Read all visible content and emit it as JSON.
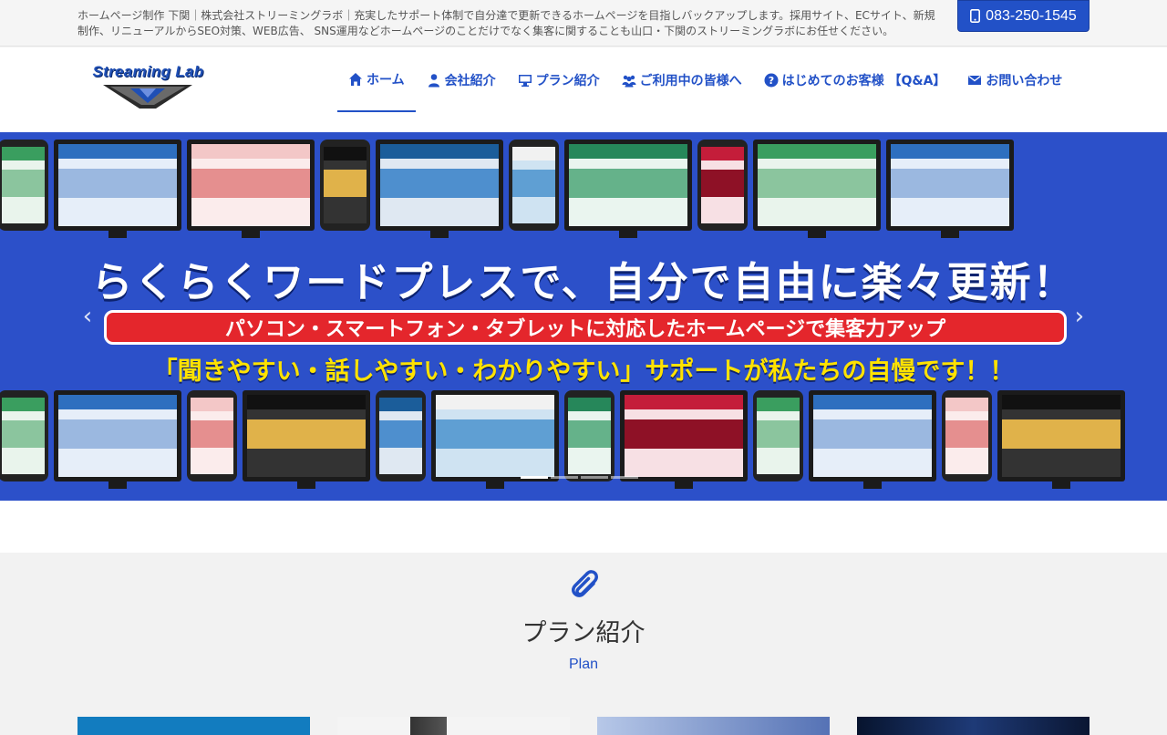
{
  "topbar": {
    "text": "ホームページ制作 下関｜株式会社ストリーミングラボ｜充実したサポート体制で自分達で更新できるホームページを目指しバックアップします。採用サイト、ECサイト、新規制作、リニューアルからSEO対策、WEB広告、 SNS運用などホームページのことだけでなく集客に関することも山口・下関のストリーミングラボにお任せください。",
    "phone": "083-250-1545",
    "phone_icon": "mobile-phone-icon"
  },
  "header": {
    "logo_text": "Streaming Lab",
    "nav": [
      {
        "label": "ホーム",
        "icon": "home-icon",
        "active": true
      },
      {
        "label": "会社紹介",
        "icon": "person-icon",
        "active": false
      },
      {
        "label": "プラン紹介",
        "icon": "monitor-icon",
        "active": false
      },
      {
        "label": "ご利用中の皆様へ",
        "icon": "group-icon",
        "active": false
      },
      {
        "label": "はじめてのお客様 【Q&A】",
        "icon": "question-icon",
        "active": false
      },
      {
        "label": "お問い合わせ",
        "icon": "mail-icon",
        "active": false
      }
    ]
  },
  "hero": {
    "headline": "らくらくワードプレスで、自分で自由に楽々更新！",
    "ribbon": "パソコン・スマートフォン・タブレットに対応したホームページで集客力アップ",
    "sub": "「聞きやすい・話しやすい・わかりやすい」サポートが私たちの自慢です！！",
    "prev": "‹",
    "next": "›",
    "slide_count": 4,
    "active_slide": 1
  },
  "plan": {
    "icon": "paperclip-icon",
    "title": "プラン紹介",
    "subtitle": "Plan"
  },
  "colors": {
    "brand_blue": "#2251c7",
    "hero_bg": "#2c50c9",
    "ribbon_red": "#e4262c",
    "sub_yellow": "#ffe200"
  }
}
